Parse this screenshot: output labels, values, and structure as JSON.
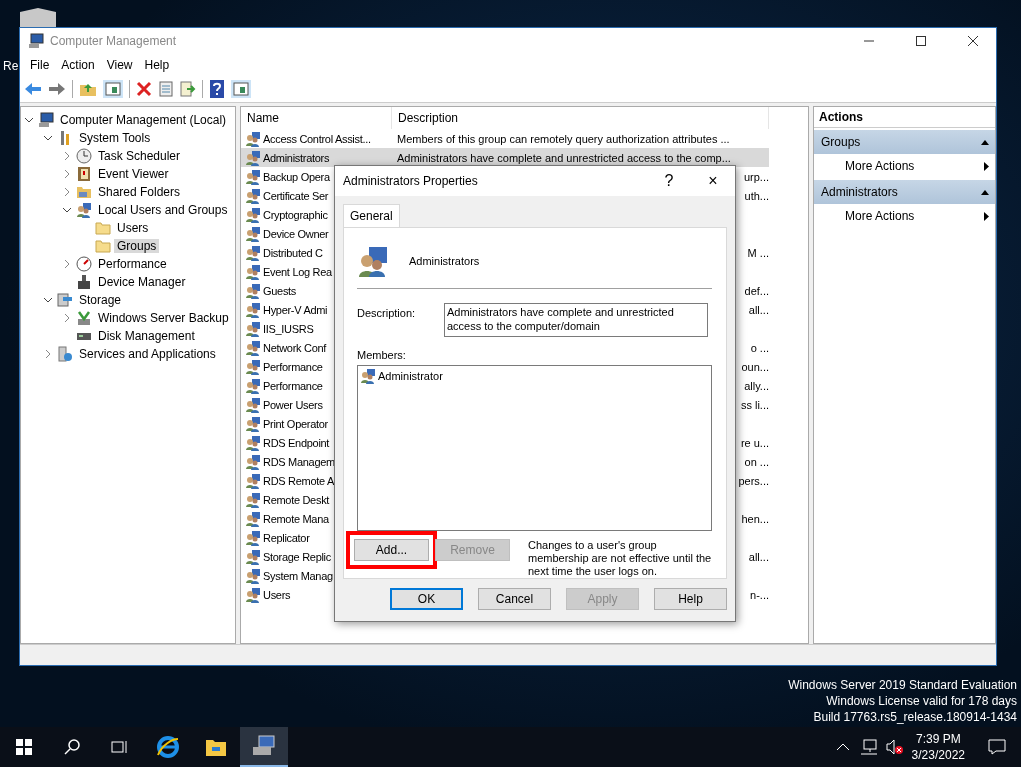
{
  "desktop": {
    "icon_label": "Re"
  },
  "window": {
    "title": "Computer Management",
    "menu": [
      "File",
      "Action",
      "View",
      "Help"
    ],
    "toolbar": [
      {
        "kind": "back"
      },
      {
        "kind": "forward"
      },
      {
        "kind": "sep"
      },
      {
        "kind": "up"
      },
      {
        "kind": "pane"
      },
      {
        "kind": "sep"
      },
      {
        "kind": "delete"
      },
      {
        "kind": "properties"
      },
      {
        "kind": "export"
      },
      {
        "kind": "sep"
      },
      {
        "kind": "help"
      },
      {
        "kind": "pane"
      }
    ]
  },
  "tree": [
    {
      "label": "Computer Management (Local)",
      "kind": "computer",
      "expanded": true,
      "selected": false,
      "children": [
        {
          "label": "System Tools",
          "kind": "tools",
          "expanded": true,
          "selected": false,
          "children": [
            {
              "label": "Task Scheduler",
              "kind": "clock",
              "expanded": false,
              "selected": false
            },
            {
              "label": "Event Viewer",
              "kind": "log",
              "expanded": false,
              "selected": false
            },
            {
              "label": "Shared Folders",
              "kind": "share",
              "expanded": false,
              "selected": false
            },
            {
              "label": "Local Users and Groups",
              "kind": "users",
              "expanded": true,
              "selected": false,
              "children": [
                {
                  "label": "Users",
                  "kind": "folder",
                  "selected": false
                },
                {
                  "label": "Groups",
                  "kind": "folder",
                  "selected": true
                }
              ]
            },
            {
              "label": "Performance",
              "kind": "gauge",
              "expanded": false,
              "selected": false
            },
            {
              "label": "Device Manager",
              "kind": "device",
              "selected": false
            }
          ]
        },
        {
          "label": "Storage",
          "kind": "storage",
          "expanded": true,
          "selected": false,
          "children": [
            {
              "label": "Windows Server Backup",
              "kind": "backup",
              "expanded": false,
              "selected": false
            },
            {
              "label": "Disk Management",
              "kind": "disk",
              "selected": false
            }
          ]
        },
        {
          "label": "Services and Applications",
          "kind": "services",
          "expanded": false,
          "selected": false
        }
      ]
    }
  ],
  "list": {
    "columns": [
      "Name",
      "Description"
    ],
    "rows": [
      {
        "name": "Access Control Assist...",
        "description": "Members of this group can remotely query authorization attributes ...",
        "selected": false
      },
      {
        "name": "Administrators",
        "description": "Administrators have complete and unrestricted access to the comp...",
        "selected": true
      },
      {
        "name": "Backup Opera",
        "description_tail": "urp...",
        "selected": false
      },
      {
        "name": "Certificate Ser",
        "description_tail": "uth...",
        "selected": false
      },
      {
        "name": "Cryptographic",
        "selected": false
      },
      {
        "name": "Device Owner",
        "selected": false
      },
      {
        "name": "Distributed C",
        "description_tail": "M ...",
        "selected": false
      },
      {
        "name": "Event Log Rea",
        "selected": false
      },
      {
        "name": "Guests",
        "description_tail": "def...",
        "selected": false
      },
      {
        "name": "Hyper-V Admi",
        "description_tail": "all...",
        "selected": false
      },
      {
        "name": "IIS_IUSRS",
        "selected": false
      },
      {
        "name": "Network Conf",
        "description_tail": "o ...",
        "selected": false
      },
      {
        "name": "Performance",
        "description_tail": "oun...",
        "selected": false
      },
      {
        "name": "Performance",
        "description_tail": "ally...",
        "selected": false
      },
      {
        "name": "Power Users",
        "description_tail": "ss li...",
        "selected": false
      },
      {
        "name": "Print Operator",
        "selected": false
      },
      {
        "name": "RDS Endpoint",
        "description_tail": "re u...",
        "selected": false
      },
      {
        "name": "RDS Managem",
        "description_tail": "on ...",
        "selected": false
      },
      {
        "name": "RDS Remote A",
        "description_tail": "pers...",
        "selected": false
      },
      {
        "name": "Remote Deskt",
        "selected": false
      },
      {
        "name": "Remote Mana",
        "description_tail": "hen...",
        "selected": false
      },
      {
        "name": "Replicator",
        "selected": false
      },
      {
        "name": "Storage Replic",
        "description_tail": "all...",
        "selected": false
      },
      {
        "name": "System Manag",
        "selected": false
      },
      {
        "name": "Users",
        "description_tail": "n-...",
        "selected": false
      }
    ]
  },
  "actions": {
    "title": "Actions",
    "sections": [
      {
        "title": "Groups",
        "expanded": true,
        "items": [
          "More Actions"
        ]
      },
      {
        "title": "Administrators",
        "expanded": true,
        "items": [
          "More Actions"
        ]
      }
    ]
  },
  "dialog": {
    "title": "Administrators Properties",
    "help": "?",
    "close": "×",
    "tabs": [
      {
        "label": "General",
        "selected": true
      }
    ],
    "group_name": "Administrators",
    "description_label": "Description:",
    "description": "Administrators have complete and unrestricted access to the computer/domain",
    "members_label": "Members:",
    "members": [
      {
        "name": "Administrator",
        "selected": false
      }
    ],
    "member_buttons": [
      {
        "label": "Add...",
        "disabled": false,
        "highlighted": true
      },
      {
        "label": "Remove",
        "disabled": true,
        "highlighted": false
      }
    ],
    "note": "Changes to a user's group membership are not effective until the next time the user logs on.",
    "buttons": [
      {
        "label": "OK",
        "disabled": false,
        "default": true
      },
      {
        "label": "Cancel",
        "disabled": false,
        "default": false
      },
      {
        "label": "Apply",
        "disabled": true,
        "default": false
      },
      {
        "label": "Help",
        "disabled": false,
        "default": false
      }
    ]
  },
  "watermark_lines": [
    "Windows Server 2019 Standard Evaluation",
    "Windows License valid for 178 days",
    "Build 17763.rs5_release.180914-1434"
  ],
  "taskbar": {
    "apps": [
      {
        "kind": "ie",
        "active": false
      },
      {
        "kind": "explorer",
        "active": false
      },
      {
        "kind": "compmgmt",
        "active": true
      }
    ],
    "time": "7:39 PM",
    "date": "3/23/2022"
  }
}
